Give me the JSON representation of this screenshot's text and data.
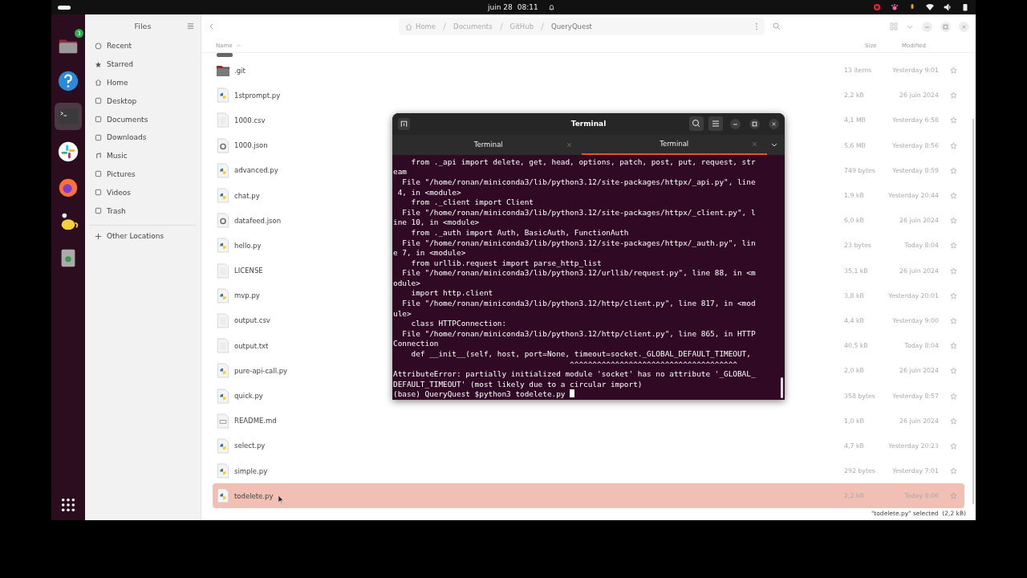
{
  "top_bar": {
    "date": "juin 28",
    "time": "08:11"
  },
  "dock": [
    {
      "kind": "files",
      "badge": "3",
      "active": false
    },
    {
      "kind": "help",
      "active": false
    },
    {
      "kind": "terminal",
      "active": true
    },
    {
      "kind": "chat",
      "active": false
    },
    {
      "kind": "browser",
      "active": false
    },
    {
      "kind": "teapot",
      "active": false
    },
    {
      "kind": "trash",
      "active": false
    }
  ],
  "sidebar": {
    "title": "Files",
    "items": [
      {
        "label": "Recent",
        "kind": "recent"
      },
      {
        "label": "Starred",
        "kind": "starred"
      },
      {
        "label": "Home",
        "kind": "home"
      },
      {
        "label": "Desktop",
        "kind": "desktop"
      },
      {
        "label": "Documents",
        "kind": "documents"
      },
      {
        "label": "Downloads",
        "kind": "downloads"
      },
      {
        "label": "Music",
        "kind": "music"
      },
      {
        "label": "Pictures",
        "kind": "pictures"
      },
      {
        "label": "Videos",
        "kind": "videos"
      },
      {
        "label": "Trash",
        "kind": "trash"
      }
    ],
    "other": "Other Locations"
  },
  "breadcrumb": [
    "Home",
    "Documents",
    "GitHub",
    "QueryQuest"
  ],
  "table": {
    "columns": [
      "Name",
      "Size",
      "Modified"
    ],
    "rows": [
      {
        "name": ".git",
        "kind": "folder",
        "size": "13 items",
        "modified": "Yesterday 9:01",
        "selected": false
      },
      {
        "name": "1stprompt.py",
        "kind": "python",
        "size": "2,2 kB",
        "modified": "26 juin 2024",
        "selected": false
      },
      {
        "name": "1000.csv",
        "kind": "text",
        "size": "4,1 MB",
        "modified": "Yesterday 6:58",
        "selected": false
      },
      {
        "name": "1000.json",
        "kind": "json",
        "size": "5,6 MB",
        "modified": "Yesterday 8:56",
        "selected": false
      },
      {
        "name": "advanced.py",
        "kind": "python",
        "size": "749 bytes",
        "modified": "Yesterday 8:59",
        "selected": false
      },
      {
        "name": "chat.py",
        "kind": "python",
        "size": "1,9 kB",
        "modified": "Yesterday 20:44",
        "selected": false
      },
      {
        "name": "datafeed.json",
        "kind": "json",
        "size": "6,0 kB",
        "modified": "26 juin 2024",
        "selected": false
      },
      {
        "name": "hello.py",
        "kind": "python",
        "size": "23 bytes",
        "modified": "Today 8:04",
        "selected": false
      },
      {
        "name": "LICENSE",
        "kind": "text",
        "size": "35,1 kB",
        "modified": "26 juin 2024",
        "selected": false
      },
      {
        "name": "mvp.py",
        "kind": "python",
        "size": "3,8 kB",
        "modified": "Yesterday 20:01",
        "selected": false
      },
      {
        "name": "output.csv",
        "kind": "text",
        "size": "4,4 kB",
        "modified": "Yesterday 9:00",
        "selected": false
      },
      {
        "name": "output.txt",
        "kind": "text",
        "size": "40,5 kB",
        "modified": "Today 8:04",
        "selected": false
      },
      {
        "name": "pure-api-call.py",
        "kind": "python",
        "size": "2,0 kB",
        "modified": "26 juin 2024",
        "selected": false
      },
      {
        "name": "quick.py",
        "kind": "python",
        "size": "358 bytes",
        "modified": "Yesterday 8:57",
        "selected": false
      },
      {
        "name": "README.md",
        "kind": "markdown",
        "size": "1,0 kB",
        "modified": "26 juin 2024",
        "selected": false
      },
      {
        "name": "select.py",
        "kind": "python",
        "size": "4,7 kB",
        "modified": "Yesterday 20:23",
        "selected": false
      },
      {
        "name": "simple.py",
        "kind": "python",
        "size": "292 bytes",
        "modified": "Yesterday 7:01",
        "selected": false
      },
      {
        "name": "todelete.py",
        "kind": "python",
        "size": "2,2 kB",
        "modified": "Today 8:06",
        "selected": true
      }
    ]
  },
  "status": "\"todelete.py\" selected  (2,2 kB)",
  "terminal": {
    "title": "Terminal",
    "tabs": [
      {
        "label": "Terminal",
        "selected": false
      },
      {
        "label": "Terminal",
        "selected": true
      }
    ],
    "lines": [
      "    from ._api import delete, get, head, options, patch, post, put, request, str",
      "eam",
      "  File \"/home/ronan/miniconda3/lib/python3.12/site-packages/httpx/_api.py\", line",
      " 4, in <module>",
      "    from ._client import Client",
      "  File \"/home/ronan/miniconda3/lib/python3.12/site-packages/httpx/_client.py\", l",
      "ine 10, in <module>",
      "    from ._auth import Auth, BasicAuth, FunctionAuth",
      "  File \"/home/ronan/miniconda3/lib/python3.12/site-packages/httpx/_auth.py\", lin",
      "e 7, in <module>",
      "    from urllib.request import parse_http_list",
      "  File \"/home/ronan/miniconda3/lib/python3.12/urllib/request.py\", line 88, in <m",
      "odule>",
      "    import http.client",
      "  File \"/home/ronan/miniconda3/lib/python3.12/http/client.py\", line 817, in <mod",
      "ule>",
      "    class HTTPConnection:",
      "  File \"/home/ronan/miniconda3/lib/python3.12/http/client.py\", line 865, in HTTP",
      "Connection",
      "    def __init__(self, host, port=None, timeout=socket._GLOBAL_DEFAULT_TIMEOUT,",
      "                                       ^^^^^^^^^^^^^^^^^^^^^^^^^^^^^^^^^^^^^",
      "AttributeError: partially initialized module 'socket' has no attribute '_GLOBAL_",
      "DEFAULT_TIMEOUT' (most likely due to a circular import)",
      "(base) QueryQuest $python3 todelete.py "
    ]
  }
}
